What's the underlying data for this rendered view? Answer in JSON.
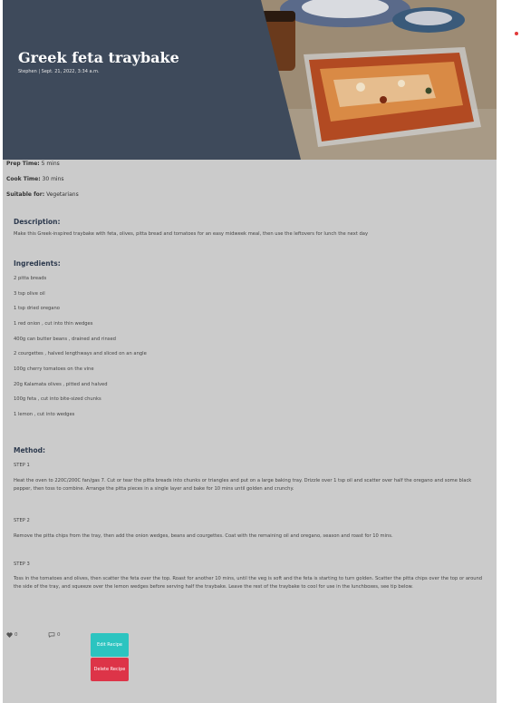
{
  "recipe": {
    "title": "Greek feta traybake",
    "meta": "Stephen | Sept. 21, 2022, 3:34 a.m.",
    "prep_label": "Prep Time:",
    "prep_value": "5 mins",
    "cook_label": "Cook Time:",
    "cook_value": "30 mins",
    "suitable_label": "Suitable for:",
    "suitable_value": "Vegetarians"
  },
  "description": {
    "heading": "Description:",
    "text": "Make this Greek-inspired traybake with feta, olives, pitta bread and tomatoes for an easy midweek meal, then use the leftovers for lunch the next day"
  },
  "ingredients": {
    "heading": "Ingredients:",
    "items": [
      "2 pitta breads",
      "3 tsp olive oil",
      "1 tsp dried oregano",
      "1 red onion , cut into thin wedges",
      "400g can butter beans , drained and rinsed",
      "2 courgettes , halved lengthways and sliced on an angle",
      "100g cherry tomatoes on the vine",
      "20g Kalamata olives , pitted and halved",
      "100g feta , cut into bite-sized chunks",
      "1 lemon , cut into wedges"
    ]
  },
  "method": {
    "heading": "Method:",
    "steps": [
      {
        "label": "STEP 1",
        "text": "Heat the oven to 220C/200C fan/gas 7. Cut or tear the pitta breads into chunks or triangles and put on a large baking tray. Drizzle over 1 tsp oil and scatter over half the oregano and some black pepper, then toss to combine. Arrange the pitta pieces in a single layer and bake for 10 mins until golden and crunchy."
      },
      {
        "label": "STEP 2",
        "text": "Remove the pitta chips from the tray, then add the onion wedges, beans and courgettes. Coat with the remaining oil and oregano, season and roast for 10 mins."
      },
      {
        "label": "STEP 3",
        "text": "Toss in the tomatoes and olives, then scatter the feta over the top. Roast for another 10 mins, until the veg is soft and the feta is starting to turn golden. Scatter the pitta chips over the top or around the side of the tray, and squeeze over the lemon wedges before serving half the traybake. Leave the rest of the traybake to cool for use in the lunchboxes, see tip below."
      }
    ]
  },
  "actions": {
    "likes": "0",
    "comments": "0",
    "edit_label": "Edit Recipe",
    "delete_label": "Delete Recipe"
  },
  "colors": {
    "hero_panel": "#3e4a5b",
    "edit_button": "#2cc4c0",
    "delete_button": "#dd3448",
    "card_bg": "#cbcbcb"
  },
  "icons": {
    "likes": "heart-icon",
    "comments": "comment-icon"
  }
}
